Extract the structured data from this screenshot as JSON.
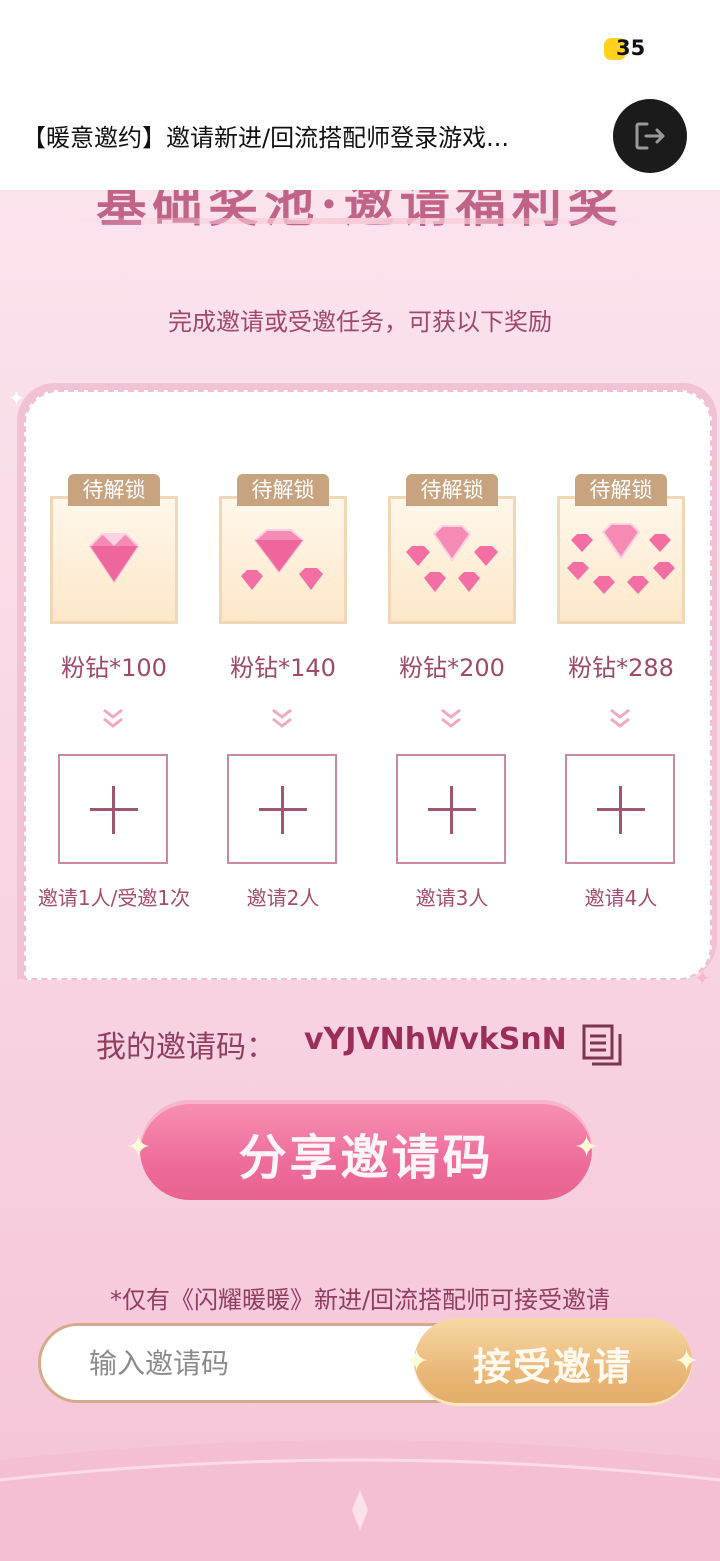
{
  "status_bar": {
    "battery": "35"
  },
  "title_bar": {
    "title": "【暖意邀约】邀请新进/回流搭配师登录游戏..."
  },
  "banner": {
    "title": "基础奖池·邀请福利奖",
    "subtitle": "完成邀请或受邀任务，可获以下奖励"
  },
  "rewards": [
    {
      "tag": "待解锁",
      "name": "粉钻*100",
      "condition": "邀请1人/受邀1次"
    },
    {
      "tag": "待解锁",
      "name": "粉钻*140",
      "condition": "邀请2人"
    },
    {
      "tag": "待解锁",
      "name": "粉钻*200",
      "condition": "邀请3人"
    },
    {
      "tag": "待解锁",
      "name": "粉钻*288",
      "condition": "邀请4人"
    }
  ],
  "invite_code": {
    "label": "我的邀请码：",
    "value": "vYJVNhWvkSnN"
  },
  "share_button": {
    "label": "分享邀请码"
  },
  "note": "*仅有《闪耀暖暖》新进/回流搭配师可接受邀请",
  "invite_input": {
    "placeholder": "输入邀请码"
  },
  "accept_button": {
    "label": "接受邀请"
  },
  "colors": {
    "accent_pink": "#ee6d9b",
    "text_rose": "#9c4a67",
    "gold": "#e9b878"
  },
  "icons": [
    "exit-icon",
    "copy-icon",
    "chevron-double-down-icon",
    "plus-icon",
    "pink-diamond-icon"
  ]
}
